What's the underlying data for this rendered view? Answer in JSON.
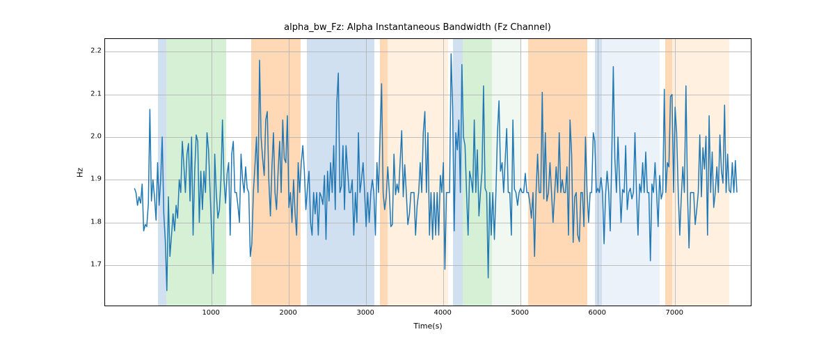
{
  "chart_data": {
    "type": "line",
    "title": "alpha_bw_Fz: Alpha Instantaneous Bandwidth (Fz Channel)",
    "xlabel": "Time(s)",
    "ylabel": "Hz",
    "xlim": [
      -380,
      7980
    ],
    "ylim": [
      1.605,
      2.23
    ],
    "xticks": [
      1000,
      2000,
      3000,
      4000,
      5000,
      6000,
      7000
    ],
    "yticks": [
      1.7,
      1.8,
      1.9,
      2.0,
      2.1,
      2.2
    ],
    "bands": [
      {
        "x0": 305,
        "x1": 415,
        "color": "#6699cc"
      },
      {
        "x0": 415,
        "x1": 1190,
        "color": "#77cc77"
      },
      {
        "x0": 1510,
        "x1": 2150,
        "color": "#ff7f0e"
      },
      {
        "x0": 2230,
        "x1": 2370,
        "color": "#6699cc"
      },
      {
        "x0": 2370,
        "x1": 3110,
        "color": "#6699cc"
      },
      {
        "x0": 3180,
        "x1": 3280,
        "color": "#ff7f0e"
      },
      {
        "x0": 3280,
        "x1": 4060,
        "color": "#ffcc99"
      },
      {
        "x0": 4120,
        "x1": 4250,
        "color": "#6699cc"
      },
      {
        "x0": 4250,
        "x1": 4630,
        "color": "#77cc77"
      },
      {
        "x0": 4630,
        "x1": 5010,
        "color": "#d0e8d0"
      },
      {
        "x0": 5100,
        "x1": 5860,
        "color": "#ff7f0e"
      },
      {
        "x0": 5960,
        "x1": 6050,
        "color": "#6699cc"
      },
      {
        "x0": 6050,
        "x1": 6800,
        "color": "#bcd4ea"
      },
      {
        "x0": 6870,
        "x1": 6960,
        "color": "#ff7f0e"
      },
      {
        "x0": 6960,
        "x1": 7700,
        "color": "#ffcc99"
      }
    ],
    "series": [
      {
        "name": "alpha_bw_Fz",
        "color": "#1f77b4",
        "x_step": 20,
        "y": [
          1.88,
          1.87,
          1.84,
          1.86,
          1.845,
          1.89,
          1.78,
          1.795,
          1.79,
          1.843,
          2.065,
          1.85,
          1.9,
          1.86,
          1.805,
          1.94,
          1.84,
          1.9,
          2.0,
          1.82,
          1.755,
          1.64,
          1.86,
          1.72,
          1.77,
          1.82,
          1.78,
          1.84,
          1.81,
          1.9,
          1.87,
          1.99,
          1.935,
          1.87,
          1.96,
          1.985,
          1.85,
          2.0,
          1.77,
          1.92,
          2.005,
          1.99,
          1.8,
          1.92,
          1.83,
          1.92,
          1.87,
          2.01,
          1.97,
          1.87,
          1.77,
          1.68,
          1.96,
          1.87,
          1.81,
          1.83,
          1.9,
          2.04,
          1.9,
          1.845,
          1.915,
          1.94,
          1.77,
          1.96,
          1.99,
          1.87,
          1.87,
          1.84,
          1.8,
          1.96,
          1.9,
          1.87,
          1.93,
          1.88,
          1.87,
          1.72,
          1.75,
          1.87,
          1.93,
          2.0,
          1.87,
          2.18,
          2.0,
          1.95,
          1.91,
          2.04,
          2.06,
          1.9,
          1.815,
          1.93,
          2.01,
          1.87,
          1.83,
          1.92,
          1.99,
          1.87,
          2.04,
          1.95,
          1.94,
          2.05,
          1.835,
          1.87,
          1.8,
          1.9,
          1.82,
          1.77,
          1.94,
          1.87,
          1.94,
          1.98,
          1.92,
          1.83,
          1.88,
          1.92,
          1.8,
          1.77,
          1.87,
          1.82,
          1.87,
          1.77,
          1.87,
          1.86,
          1.842,
          1.91,
          1.76,
          1.92,
          1.85,
          1.94,
          1.87,
          1.98,
          1.83,
          2.08,
          2.15,
          1.87,
          1.885,
          1.98,
          1.83,
          1.98,
          1.92,
          1.87,
          1.87,
          1.9,
          1.77,
          1.87,
          1.8,
          2.01,
          1.87,
          1.9,
          1.94,
          1.87,
          1.79,
          1.87,
          1.8,
          1.87,
          1.9,
          1.87,
          1.77,
          1.94,
          1.87,
          2.005,
          2.125,
          1.87,
          1.83,
          1.86,
          1.93,
          1.87,
          1.79,
          1.795,
          1.96,
          1.865,
          1.89,
          1.87,
          1.94,
          2.015,
          1.86,
          1.935,
          1.87,
          1.795,
          1.82,
          1.87,
          1.87,
          1.87,
          1.77,
          1.84,
          1.87,
          1.94,
          1.87,
          2.01,
          2.06,
          1.87,
          2.01,
          1.77,
          1.87,
          1.76,
          1.87,
          1.77,
          1.87,
          1.77,
          1.91,
          1.87,
          1.94,
          1.69,
          1.87,
          1.87,
          1.87,
          2.195,
          2.07,
          1.78,
          2.01,
          1.97,
          2.04,
          1.87,
          2.17,
          2.0,
          1.98,
          1.87,
          1.77,
          1.92,
          1.9,
          1.87,
          2.04,
          1.87,
          1.97,
          1.815,
          1.87,
          1.92,
          2.12,
          1.88,
          1.87,
          1.67,
          1.87,
          1.77,
          1.87,
          1.76,
          1.87,
          2.01,
          2.085,
          1.92,
          1.94,
          1.87,
          1.945,
          2.02,
          1.87,
          1.87,
          1.77,
          2.04,
          1.878,
          1.87,
          1.84,
          1.87,
          1.88,
          1.87,
          1.87,
          1.915,
          1.87,
          1.87,
          1.845,
          1.81,
          1.87,
          1.72,
          1.87,
          1.96,
          1.87,
          1.87,
          2.105,
          1.855,
          2.01,
          1.85,
          1.87,
          1.94,
          1.87,
          1.8,
          1.865,
          1.93,
          1.87,
          2.01,
          1.87,
          1.9,
          1.87,
          1.87,
          1.93,
          1.77,
          2.04,
          1.96,
          1.753,
          1.86,
          1.87,
          1.77,
          1.755,
          1.87,
          1.87,
          1.79,
          2.0,
          1.87,
          1.8,
          1.87,
          1.87,
          2.01,
          1.99,
          1.87,
          1.88,
          1.87,
          1.905,
          1.87,
          1.75,
          1.865,
          1.92,
          1.87,
          1.78,
          1.955,
          2.165,
          1.95,
          1.87,
          2.0,
          1.9,
          1.8,
          1.877,
          1.87,
          1.98,
          1.83,
          1.87,
          1.88,
          1.855,
          1.87,
          2.01,
          1.87,
          1.77,
          1.89,
          1.87,
          1.94,
          1.87,
          1.965,
          1.87,
          1.87,
          1.71,
          1.89,
          1.87,
          1.94,
          1.87,
          1.79,
          1.91,
          1.855,
          1.87,
          2.112,
          1.87,
          1.94,
          1.93,
          2.095,
          2.1,
          1.87,
          2.07,
          2.01,
          1.87,
          1.77,
          1.86,
          1.93,
          1.87,
          2.12,
          1.87,
          1.74,
          1.87,
          1.87,
          1.87,
          1.795,
          1.83,
          1.87,
          2.005,
          1.86,
          1.975,
          1.925,
          2.002,
          1.77,
          2.05,
          1.87,
          1.965,
          1.835,
          1.87,
          1.93,
          1.87,
          2.005,
          1.92,
          1.892,
          2.075,
          1.87,
          1.96,
          1.875,
          1.87,
          1.94,
          1.87,
          1.945,
          1.87
        ]
      }
    ]
  }
}
